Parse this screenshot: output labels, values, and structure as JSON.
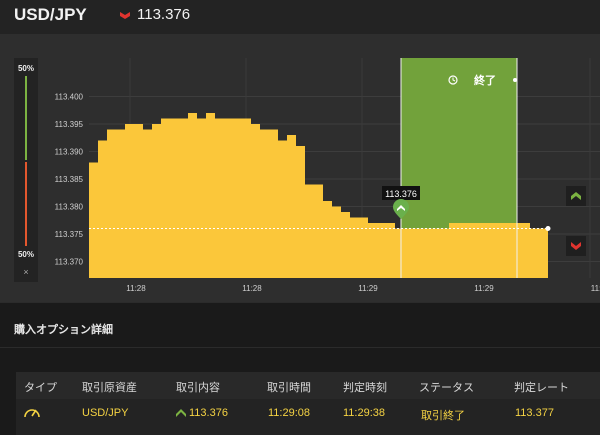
{
  "header": {
    "pair": "USD/JPY",
    "rate": "113.376",
    "direction_icon": "down-chevron-icon",
    "direction_color": "#e0342f"
  },
  "meter": {
    "top_label": "50%",
    "bottom_label": "50%",
    "close_label": "×",
    "up_color": "#7cb342",
    "down_color": "#e4572e"
  },
  "chart_data": {
    "type": "area",
    "title": "",
    "xlabel": "",
    "ylabel": "",
    "y_ticks": [
      "113.400",
      "113.395",
      "113.390",
      "113.385",
      "113.380",
      "113.375",
      "113.370"
    ],
    "x_ticks": [
      "11:28",
      "11:28",
      "11:29",
      "11:29",
      "11:"
    ],
    "ylim": [
      113.367,
      113.407
    ],
    "grid": true,
    "fill_color": "#fbc73a",
    "series": [
      {
        "values": [
          113.388,
          113.392,
          113.394,
          113.394,
          113.395,
          113.395,
          113.394,
          113.395,
          113.396,
          113.396,
          113.396,
          113.397,
          113.396,
          113.397,
          113.396,
          113.396,
          113.396,
          113.396,
          113.395,
          113.394,
          113.394,
          113.392,
          113.393,
          113.391,
          113.384,
          113.384,
          113.381,
          113.38,
          113.379,
          113.378,
          113.378,
          113.377,
          113.377,
          113.377,
          113.376,
          113.376,
          113.376,
          113.376,
          113.376,
          113.376,
          113.377,
          113.377,
          113.377,
          113.377,
          113.377,
          113.377,
          113.377,
          113.377,
          113.377,
          113.376,
          113.376,
          113.376
        ]
      }
    ],
    "current_rate": 113.376,
    "current_rate_label": "113.376",
    "highlight_window_label": "終了",
    "highlight_color": "#7cb342"
  },
  "section": {
    "title": "購入オプション詳細"
  },
  "table": {
    "columns": [
      "タイプ",
      "取引原資産",
      "取引内容",
      "取引時間",
      "判定時刻",
      "ステータス",
      "判定レート"
    ],
    "row": {
      "type_icon": "gauge-icon",
      "asset": "USD/JPY",
      "trade_icon": "up-chevron-icon",
      "trade_rate": "113.376",
      "trade_time": "11:29:08",
      "judge_time": "11:29:38",
      "status": "取引終了",
      "judge_rate": "113.377"
    },
    "accent_color": "#f5d343"
  }
}
